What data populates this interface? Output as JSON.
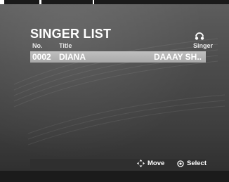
{
  "screen": {
    "title": "SINGER LIST",
    "columns": {
      "number": "No.",
      "title": "Title",
      "singer": "Singer"
    },
    "rows": [
      {
        "number": "0002",
        "title": "DIANA",
        "singer": "DAAAY SH..",
        "selected": true
      }
    ],
    "footer": {
      "move_label": "Move",
      "select_label": "Select",
      "move_icon": "four-way-arrow-icon",
      "select_icon": "select-circle-icon"
    },
    "colors": {
      "text": "#ffffff",
      "selection": "#b4b4b4",
      "background": "#4a4a4a"
    },
    "singer_icon": "singer-headphones-icon"
  }
}
